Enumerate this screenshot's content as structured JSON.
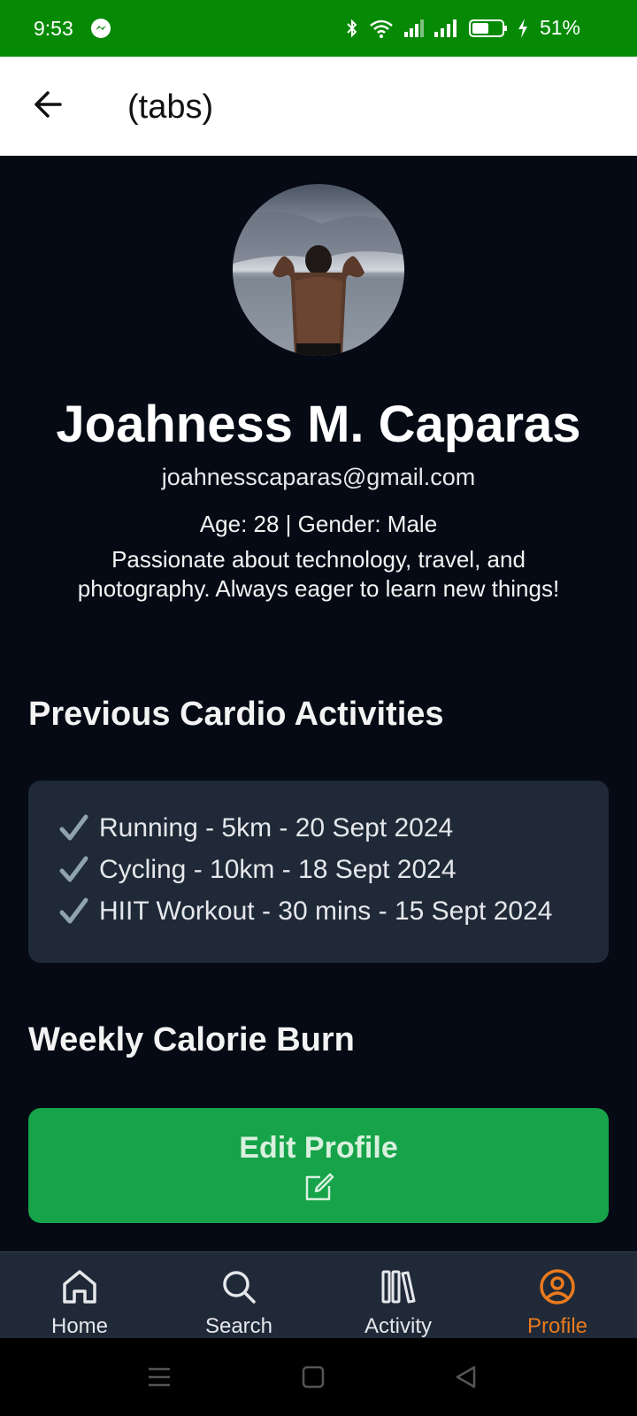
{
  "status_bar": {
    "time": "9:53",
    "battery": "51%",
    "icons": [
      "messenger-icon",
      "bluetooth-icon",
      "wifi-icon",
      "signal-icon",
      "signal-icon",
      "battery-icon",
      "charging-icon"
    ]
  },
  "app_bar": {
    "title": "(tabs)",
    "back_icon": "arrow-left-icon"
  },
  "profile": {
    "name": "Joahness M. Caparas",
    "email": "joahnesscaparas@gmail.com",
    "age_gender": "Age: 28 | Gender: Male",
    "bio": "Passionate about technology, travel, and photography. Always eager to learn new things!"
  },
  "cardio": {
    "title": "Previous Cardio Activities",
    "items": [
      "Running - 5km - 20 Sept 2024",
      "Cycling - 10km - 18 Sept 2024",
      "HIIT Workout - 30 mins - 15 Sept 2024"
    ]
  },
  "calorie": {
    "title": "Weekly Calorie Burn"
  },
  "edit_button": {
    "label": "Edit Profile"
  },
  "bottom_nav": {
    "items": [
      {
        "label": "Home",
        "icon": "home-icon"
      },
      {
        "label": "Search",
        "icon": "search-icon"
      },
      {
        "label": "Activity",
        "icon": "library-icon"
      },
      {
        "label": "Profile",
        "icon": "user-circle-icon"
      }
    ],
    "active": "Profile"
  },
  "colors": {
    "status_bar": "#068a06",
    "background": "#050a14",
    "card": "#1f2937",
    "accent_green": "#16a34a",
    "active_tab": "#ea7a1e"
  }
}
